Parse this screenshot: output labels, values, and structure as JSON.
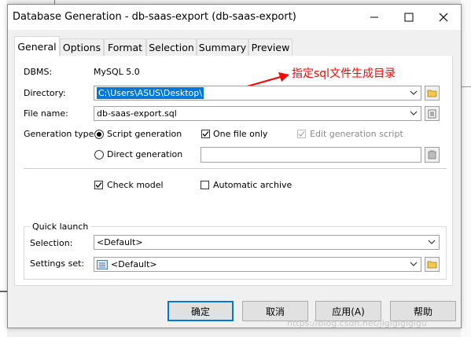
{
  "window": {
    "title": "Database Generation - db-saas-export (db-saas-export)"
  },
  "tabs": [
    {
      "label": "General",
      "active": true
    },
    {
      "label": "Options"
    },
    {
      "label": "Format"
    },
    {
      "label": "Selection"
    },
    {
      "label": "Summary"
    },
    {
      "label": "Preview"
    }
  ],
  "general": {
    "dbms_label": "DBMS:",
    "dbms_value": "MySQL 5.0",
    "directory_label": "Directory:",
    "directory_value": "C:\\Users\\ASUS\\Desktop\\",
    "filename_label": "File name:",
    "filename_value": "db-saas-export.sql",
    "generation_type_label": "Generation type:",
    "script_generation": {
      "label": "Script generation",
      "checked": true
    },
    "direct_generation": {
      "label": "Direct generation",
      "checked": false
    },
    "one_file_only": {
      "label": "One file only",
      "checked": true
    },
    "edit_generation_script": {
      "label": "Edit generation script",
      "checked": true,
      "disabled": true
    },
    "check_model": {
      "label": "Check model",
      "checked": true
    },
    "automatic_archive": {
      "label": "Automatic archive",
      "checked": false
    }
  },
  "quick_launch": {
    "title": "Quick launch",
    "selection_label": "Selection:",
    "selection_value": "<Default>",
    "settings_label": "Settings set:",
    "settings_value": "<Default>"
  },
  "buttons": {
    "ok": "确定",
    "cancel": "取消",
    "apply": "应用(A)",
    "help": "帮助"
  },
  "annotation": {
    "text": "指定sql文件生成目录",
    "color": "#ff0000"
  },
  "watermark": "https://blog.csdn.net/jlglglglglgu",
  "colors": {
    "selection": "#0078d7",
    "annotation": "#ff0000"
  }
}
